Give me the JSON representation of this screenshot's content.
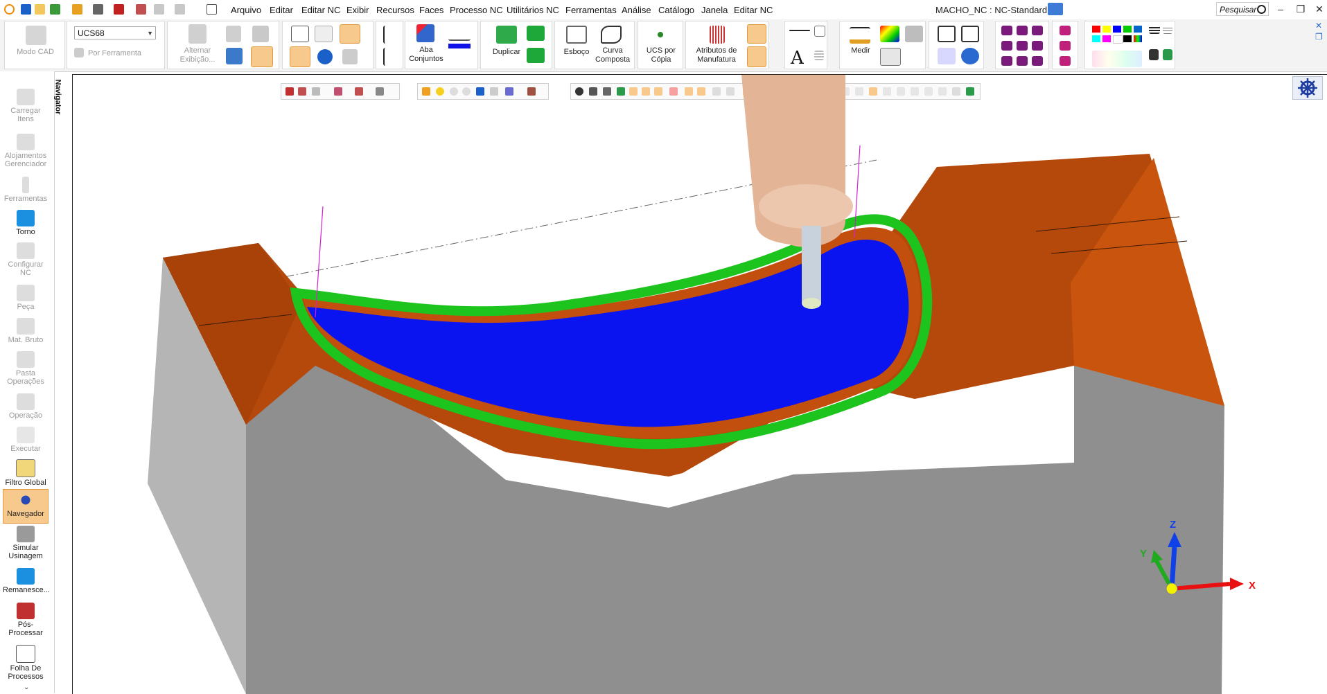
{
  "app": {
    "document_title": "MACHO_NC : NC-Standard",
    "search_placeholder": "Pesquisar"
  },
  "menu": [
    "Arquivo",
    "Editar",
    "Editar NC",
    "Exibir",
    "Recursos",
    "Faces",
    "Processo NC",
    "Utilitários NC",
    "Ferramentas",
    "Análise",
    "Catálogo",
    "Janela",
    "Editar NC"
  ],
  "ribbon": {
    "modo_cad": "Modo CAD",
    "ucs_value": "UCS68",
    "por_ferramenta": "Por Ferramenta",
    "alternar_exibicao": "Alternar Exibição...",
    "aba_conjuntos": "Aba Conjuntos",
    "duplicar": "Duplicar",
    "esboco": "Esboço",
    "curva_composta": "Curva Composta",
    "ucs_por_copia": "UCS por Cópia",
    "atributos_manufatura": "Atributos de Manufatura",
    "medir": "Medir"
  },
  "sidebar": {
    "navigator_tab": "Navigator",
    "items": [
      {
        "label": "Carregar Itens",
        "enabled": false
      },
      {
        "label": "Alojamentos Gerenciador",
        "enabled": false
      },
      {
        "label": "Ferramentas",
        "enabled": false
      },
      {
        "label": "Torno",
        "enabled": true
      },
      {
        "label": "Configurar NC",
        "enabled": false
      },
      {
        "label": "Peça",
        "enabled": false
      },
      {
        "label": "Mat. Bruto",
        "enabled": false
      },
      {
        "label": "Pasta Operações",
        "enabled": false
      },
      {
        "label": "Operação",
        "enabled": false
      },
      {
        "label": "Executar",
        "enabled": false
      },
      {
        "label": "Filtro Global",
        "enabled": true
      },
      {
        "label": "Navegador",
        "enabled": true,
        "active": true
      },
      {
        "label": "Simular Usinagem",
        "enabled": true
      },
      {
        "label": "Remanesce...",
        "enabled": true
      },
      {
        "label": "Pós-Processar",
        "enabled": true
      },
      {
        "label": "Folha De Processos",
        "enabled": true
      }
    ]
  },
  "viewport": {
    "axes": {
      "x": "X",
      "y": "Y",
      "z": "Z"
    }
  },
  "colors": {
    "cavity_floor": "#0a14f0",
    "cavity_wall_green": "#1ec41e",
    "part_top": "#b34a0a",
    "part_side": "#8e8e8e",
    "tool_holder": "#e8b89a"
  }
}
